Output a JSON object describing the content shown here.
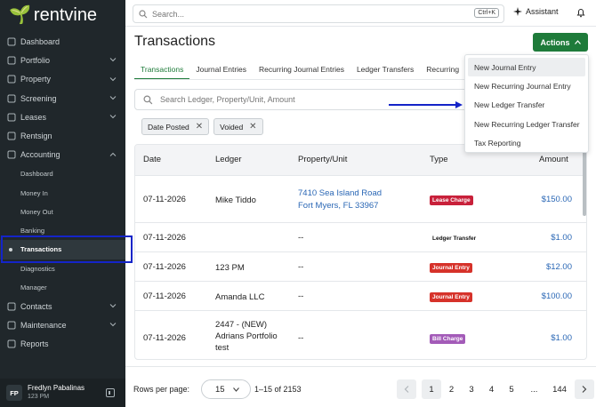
{
  "brand": {
    "name": "rentvine"
  },
  "sidebar": {
    "items": [
      {
        "label": "Dashboard",
        "icon": "grid-icon",
        "chevron": false
      },
      {
        "label": "Portfolio",
        "icon": "briefcase-icon",
        "chevron": true
      },
      {
        "label": "Property",
        "icon": "home-icon",
        "chevron": true
      },
      {
        "label": "Screening",
        "icon": "user-check-icon",
        "chevron": true
      },
      {
        "label": "Leases",
        "icon": "document-icon",
        "chevron": true
      },
      {
        "label": "Rentsign",
        "icon": "pen-icon",
        "chevron": false
      },
      {
        "label": "Accounting",
        "icon": "ledger-icon",
        "chevron": true,
        "expanded": true
      }
    ],
    "accounting_sub": [
      "Dashboard",
      "Money In",
      "Money Out",
      "Banking",
      "Transactions",
      "Diagnostics",
      "Manager"
    ],
    "active_sub": "Transactions",
    "items_after": [
      {
        "label": "Contacts",
        "icon": "contacts-icon",
        "chevron": true
      },
      {
        "label": "Maintenance",
        "icon": "wrench-icon",
        "chevron": true
      },
      {
        "label": "Reports",
        "icon": "chart-icon",
        "chevron": false
      }
    ],
    "user": {
      "initials": "FP",
      "name": "Fredlyn Pabalinas",
      "role": "123 PM"
    }
  },
  "topbar": {
    "search_placeholder": "Search...",
    "shortcut": "Ctrl+K",
    "assistant_label": "Assistant"
  },
  "page": {
    "title": "Transactions",
    "actions_label": "Actions",
    "tabs": [
      "Transactions",
      "Journal Entries",
      "Recurring Journal Entries",
      "Ledger Transfers",
      "Recurring"
    ],
    "search_placeholder": "Search Ledger, Property/Unit, Amount",
    "filters": [
      "Date Posted",
      "Voided"
    ]
  },
  "table": {
    "columns": [
      "Date",
      "Ledger",
      "Property/Unit",
      "Type",
      "Amount"
    ],
    "rows": [
      {
        "date": "07-11-2026",
        "ledger": "Mike Tiddo",
        "property": [
          "7410 Sea Island Road",
          "Fort Myers, FL 33967"
        ],
        "property_link": true,
        "type": "Lease Charge",
        "type_color": "#c8203a",
        "amount": "$150.00"
      },
      {
        "date": "07-11-2026",
        "ledger": "",
        "property": [
          "--"
        ],
        "property_link": false,
        "type": "Ledger Transfer",
        "type_color": "",
        "amount": "$1.00"
      },
      {
        "date": "07-11-2026",
        "ledger": "123 PM",
        "property": [
          "--"
        ],
        "property_link": false,
        "type": "Journal Entry",
        "type_color": "#d6322a",
        "amount": "$12.00"
      },
      {
        "date": "07-11-2026",
        "ledger": "Amanda LLC",
        "property": [
          "--"
        ],
        "property_link": false,
        "type": "Journal Entry",
        "type_color": "#d6322a",
        "amount": "$100.00"
      },
      {
        "date": "07-11-2026",
        "ledger": "2447 - (NEW) Adrians Portfolio test",
        "property": [
          "--"
        ],
        "property_link": false,
        "type": "Bill Charge",
        "type_color": "#a35bb8",
        "amount": "$1.00"
      }
    ]
  },
  "footer": {
    "rows_per_page_label": "Rows per page:",
    "rows_per_page": "15",
    "range": "1–15 of 2153",
    "pages": [
      "1",
      "2",
      "3",
      "4",
      "5",
      "...",
      "144"
    ],
    "current_page": "1"
  },
  "actions_menu": {
    "items": [
      "New Journal Entry",
      "New Recurring Journal Entry",
      "New Ledger Transfer",
      "New Recurring Ledger Transfer",
      "Tax Reporting"
    ]
  },
  "colors": {
    "brand_green": "#1e7b3a",
    "sidebar_bg": "#20272b",
    "link_blue": "#2a67b5",
    "annotation_blue": "#1424c8"
  }
}
